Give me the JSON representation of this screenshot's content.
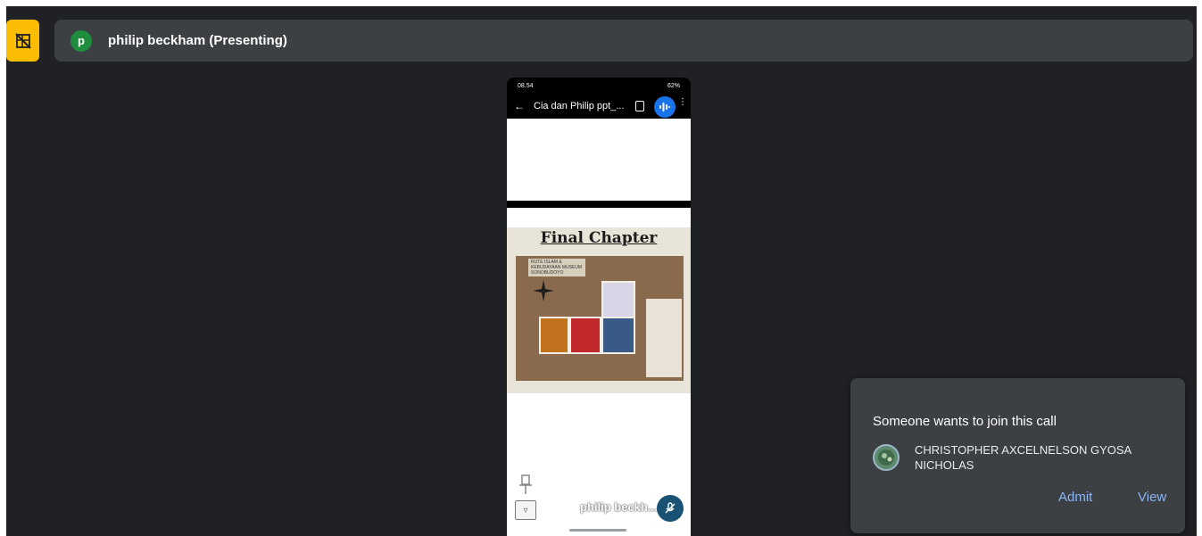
{
  "presenter": {
    "avatar_letter": "p",
    "title": "philip beckham (Presenting)"
  },
  "shared_screen": {
    "status_time": "08.54",
    "status_battery": "62%",
    "doc_title": "Cia dan Philip ppt_...",
    "slide_title": "Final Chapter",
    "map_caption": "RUTE ISLAM & KEBUDAYAAN MUSEUM SONOBUDOYO",
    "tile_name": "philip beckh..."
  },
  "join_request": {
    "title": "Someone wants to join this call",
    "guest_name": "CHRISTOPHER AXCELNELSON GYOSA NICHOLAS",
    "admit_label": "Admit",
    "view_label": "View"
  },
  "colors": {
    "stage_bg": "#202124",
    "bar_bg": "#3c4043",
    "accent_yellow": "#fbbc04",
    "action_blue": "#8ab4f8"
  },
  "icons": {
    "tile": "grid-off-icon",
    "mic": "audio-wave-icon",
    "pin": "pin-icon",
    "muted": "mic-off-icon"
  }
}
